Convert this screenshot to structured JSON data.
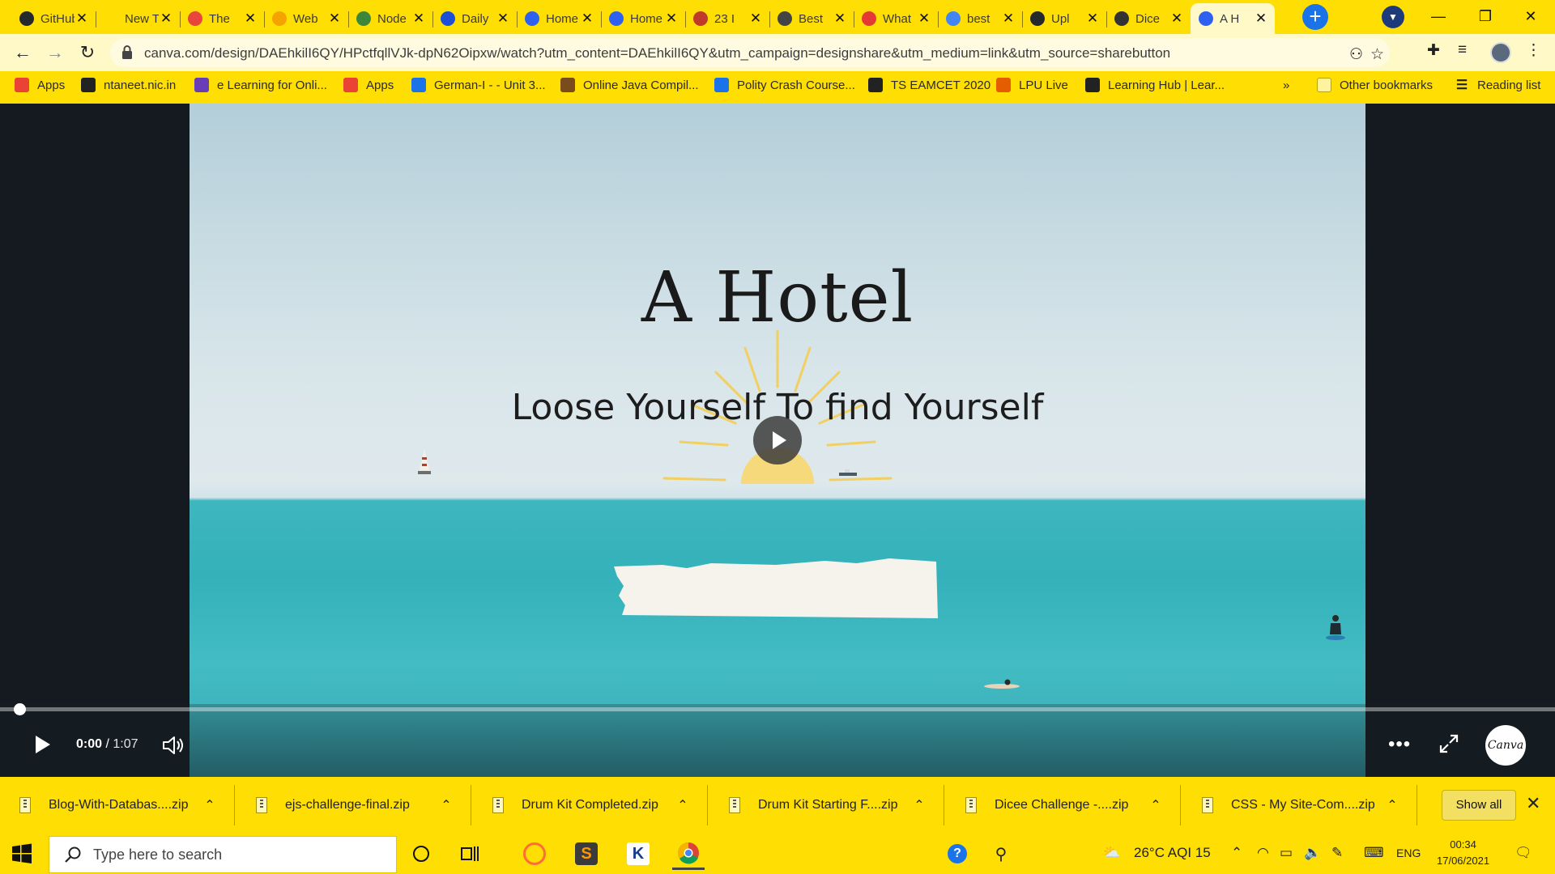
{
  "browser": {
    "tabs": [
      {
        "title": "GitHub",
        "icon": "github-icon",
        "color": "#24292e"
      },
      {
        "title": "New Tab",
        "icon": "none",
        "color": "#000000"
      },
      {
        "title": "The",
        "icon": "fire-icon",
        "color": "#e8453c"
      },
      {
        "title": "Web",
        "icon": "web-icon",
        "color": "#f4a300"
      },
      {
        "title": "Node",
        "icon": "node-icon",
        "color": "#3c873a"
      },
      {
        "title": "Daily",
        "icon": "ui-icon",
        "color": "#1d4ed8"
      },
      {
        "title": "Home",
        "icon": "canva-icon",
        "color": "#2e61f0"
      },
      {
        "title": "Home",
        "icon": "canva-icon",
        "color": "#2e61f0"
      },
      {
        "title": "23 I",
        "icon": "calendar-icon",
        "color": "#c0392b"
      },
      {
        "title": "Best",
        "icon": "search-icon",
        "color": "#444444"
      },
      {
        "title": "What",
        "icon": "alert-icon",
        "color": "#e53935"
      },
      {
        "title": "best",
        "icon": "google-icon",
        "color": "#4285f4"
      },
      {
        "title": "Upl",
        "icon": "github-icon",
        "color": "#24292e"
      },
      {
        "title": "Dice",
        "icon": "globe-icon",
        "color": "#333333"
      },
      {
        "title": "A H",
        "icon": "canva-icon",
        "color": "#2e61f0",
        "active": true
      }
    ],
    "url": "canva.com/design/DAEhkilI6QY/HPctfqllVJk-dpN62Oipxw/watch?utm_content=DAEhkilI6QY&utm_campaign=designshare&utm_medium=link&utm_source=sharebutton",
    "bookmarks": [
      {
        "label": "Apps",
        "icon": "apps-grid-icon"
      },
      {
        "label": "ntaneet.nic.in",
        "icon": "globe-icon"
      },
      {
        "label": "e Learning for Onli...",
        "icon": "elearning-icon"
      },
      {
        "label": "Apps",
        "icon": "apps-grid-icon"
      },
      {
        "label": "German-I - - Unit 3...",
        "icon": "s-icon"
      },
      {
        "label": "Online Java Compil...",
        "icon": "java-icon"
      },
      {
        "label": "Polity Crash Course...",
        "icon": "cup-icon"
      },
      {
        "label": "TS EAMCET 2020",
        "icon": "globe-icon"
      },
      {
        "label": "LPU Live",
        "icon": "lpu-icon"
      },
      {
        "label": "Learning Hub | Lear...",
        "icon": "globe-icon"
      }
    ],
    "bookmarks_overflow": "»",
    "other_bookmarks": "Other bookmarks",
    "reading_list": "Reading list"
  },
  "slide": {
    "title": "A Hotel",
    "subtitle": "Loose Yourself To find Yourself"
  },
  "player": {
    "time_current": "0:00",
    "time_separator": " / ",
    "time_total": "1:07",
    "progress": 0,
    "more_label": "•••",
    "brand": "Canva"
  },
  "downloads": {
    "items": [
      {
        "name": "Blog-With-Databas....zip"
      },
      {
        "name": "ejs-challenge-final.zip"
      },
      {
        "name": "Drum Kit Completed.zip"
      },
      {
        "name": "Drum Kit Starting F....zip"
      },
      {
        "name": "Dicee Challenge -....zip"
      },
      {
        "name": "CSS - My Site-Com....zip"
      }
    ],
    "show_all": "Show all"
  },
  "taskbar": {
    "search_placeholder": "Type here to search",
    "weather": "26°C  AQI 15",
    "language": "ENG",
    "time": "00:34",
    "date": "17/06/2021"
  }
}
